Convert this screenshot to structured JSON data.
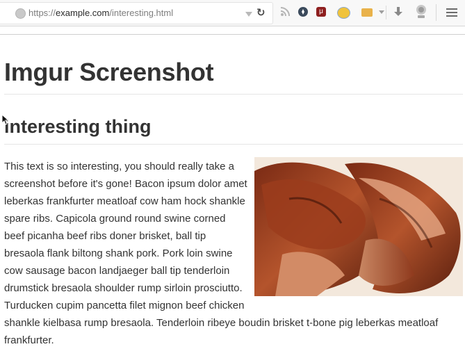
{
  "browser": {
    "url_prefix": "https://",
    "url_host": "example.com",
    "url_path": "/interesting.html",
    "ublock_letter": "μ"
  },
  "page": {
    "title": "Imgur Screenshot",
    "subtitle": "interesting thing",
    "body_text": "This text is so interesting, you should really take a screenshot before it's gone! Bacon ipsum dolor amet leberkas frankfurter meatloaf cow ham hock shankle spare ribs. Capicola ground round swine corned beef picanha beef ribs doner brisket, ball tip bresaola flank biltong shank pork. Pork loin swine cow sausage bacon landjaeger ball tip tenderloin drumstick bresaola shoulder rump sirloin prosciutto. Turducken cupim pancetta filet mignon beef chicken shankle kielbasa rump bresaola. Tenderloin ribeye boudin brisket t-bone pig leberkas meatloaf frankfurter."
  },
  "colors": {
    "text": "#333333",
    "toolbar_bg": "#f8f8f8",
    "rule": "#e6e6e6"
  },
  "icons": [
    "globe-icon",
    "dropdown-icon",
    "reload-icon",
    "rss-icon",
    "compass-icon",
    "ublock-icon",
    "home-icon",
    "extension-icon",
    "download-icon",
    "profile-badge-icon",
    "menu-icon"
  ]
}
